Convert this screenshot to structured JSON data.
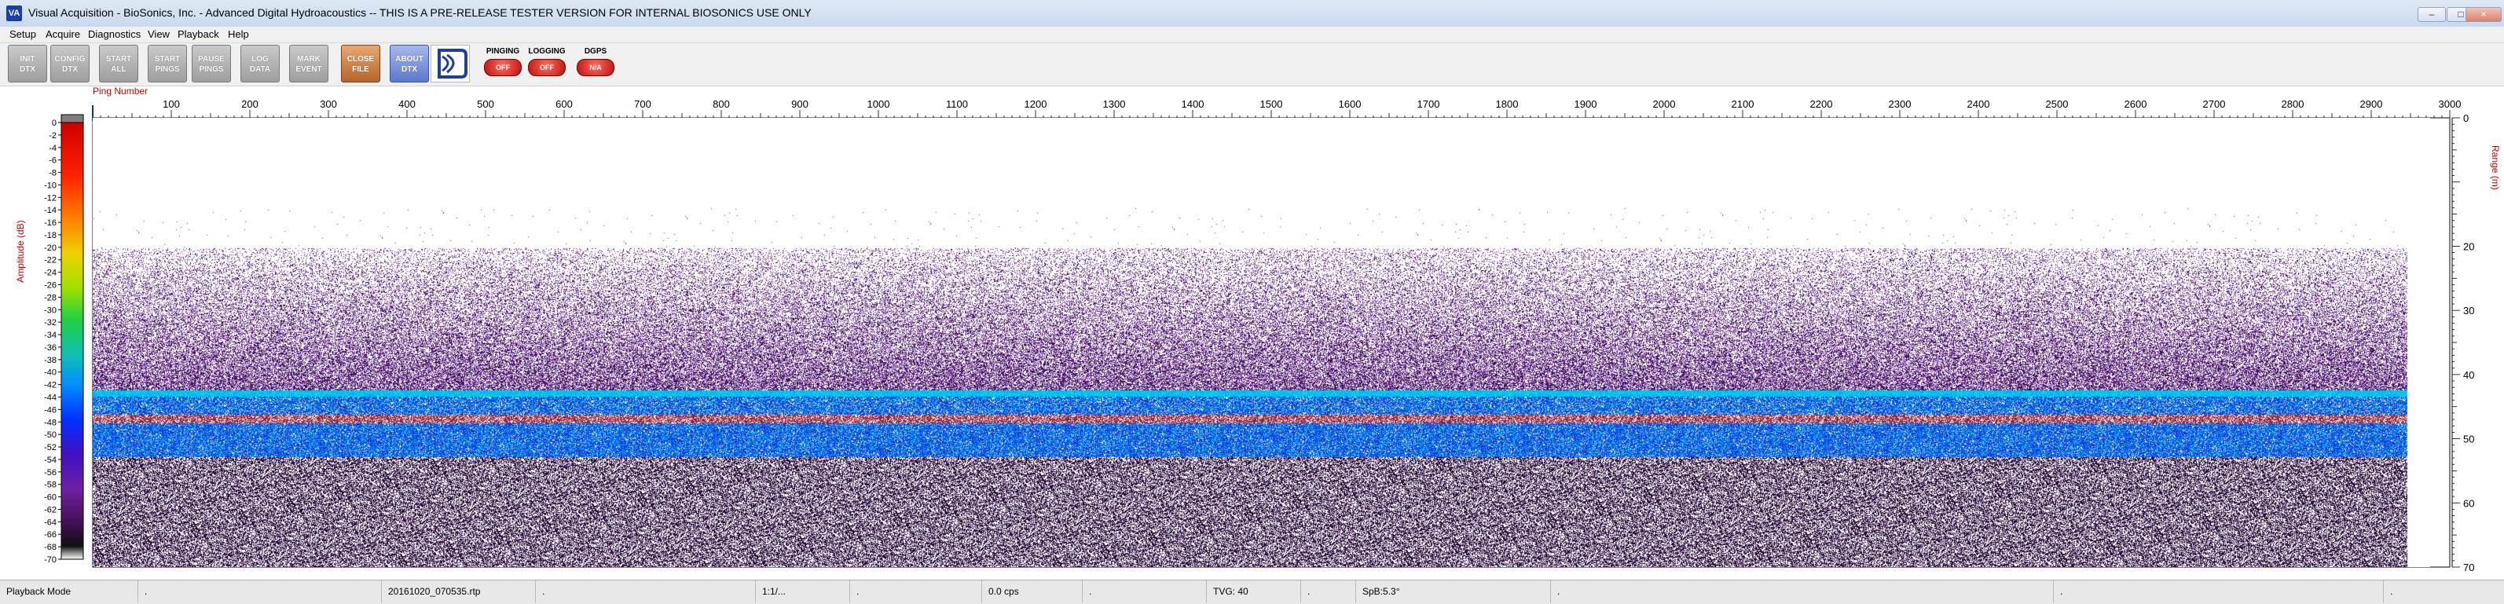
{
  "window": {
    "icon_text": "VA",
    "title": "Visual Acquisition  -  BioSonics, Inc.  -  Advanced Digital Hydroacoustics  -- THIS IS A PRE-RELEASE TESTER VERSION FOR INTERNAL BIOSONICS USE ONLY",
    "minimize_glyph": "–",
    "maximize_glyph": "□",
    "close_glyph": "×"
  },
  "menu": [
    {
      "label": "Setup"
    },
    {
      "label": "Acquire"
    },
    {
      "label": "Diagnostics"
    },
    {
      "label": "View"
    },
    {
      "label": "Playback"
    },
    {
      "label": "Help"
    }
  ],
  "toolbar": {
    "buttons": [
      {
        "label": "INIT\nDTX",
        "style": "gray"
      },
      {
        "label": "CONFIG\nDTX",
        "style": "gray"
      },
      {
        "label": "START\nALL",
        "style": "gray"
      },
      {
        "label": "START\nPINGS",
        "style": "gray"
      },
      {
        "label": "PAUSE\nPINGS",
        "style": "gray"
      },
      {
        "label": "LOG\nDATA",
        "style": "gray"
      },
      {
        "label": "MARK\nEVENT",
        "style": "gray"
      },
      {
        "label": "CLOSE\nFILE",
        "style": "orange"
      },
      {
        "label": "ABOUT\nDTX",
        "style": "blue"
      }
    ],
    "status": [
      {
        "label": "PINGING",
        "value": "OFF"
      },
      {
        "label": "LOGGING",
        "value": "OFF"
      },
      {
        "label": "DGPS",
        "value": "N/A"
      }
    ]
  },
  "echogram": {
    "x_axis_title": "Ping Number",
    "x_ticks": [
      100,
      200,
      300,
      400,
      500,
      600,
      700,
      800,
      900,
      1000,
      1100,
      1200,
      1300,
      1400,
      1500,
      1600,
      1700,
      1800,
      1900,
      2000,
      2100,
      2200,
      2300,
      2400,
      2500,
      2600,
      2700,
      2800,
      2900,
      3000
    ],
    "x_range": [
      0,
      3000
    ],
    "range_axis_title": "Range (m)",
    "range_ticks": [
      0,
      20,
      30,
      40,
      50,
      60,
      70
    ],
    "range_range": [
      0,
      70
    ],
    "amplitude_axis_title": "Amplitude (dB)",
    "amplitude_ticks": [
      0,
      -2,
      -4,
      -6,
      -8,
      -10,
      -12,
      -14,
      -16,
      -18,
      -20,
      -22,
      -24,
      -26,
      -28,
      -30,
      -32,
      -34,
      -36,
      -38,
      -40,
      -42,
      -44,
      -46,
      -48,
      -50,
      -52,
      -54,
      -56,
      -58,
      -60,
      -62,
      -64,
      -66,
      -68,
      -70
    ],
    "amplitude_range": [
      0,
      -70
    ],
    "accent_colors": {
      "axis_title": "#d00000",
      "tick_text": "#000000"
    }
  },
  "statusbar": [
    {
      "text": "Playback Mode"
    },
    {
      "text": "."
    },
    {
      "text": "20161020_070535.rtp"
    },
    {
      "text": "."
    },
    {
      "text": "1:1/..."
    },
    {
      "text": "."
    },
    {
      "text": "0.0 cps"
    },
    {
      "text": "."
    },
    {
      "text": "TVG: 40"
    },
    {
      "text": "."
    },
    {
      "text": "SpB:5.3°"
    },
    {
      "text": "."
    },
    {
      "text": "."
    },
    {
      "text": "."
    }
  ]
}
